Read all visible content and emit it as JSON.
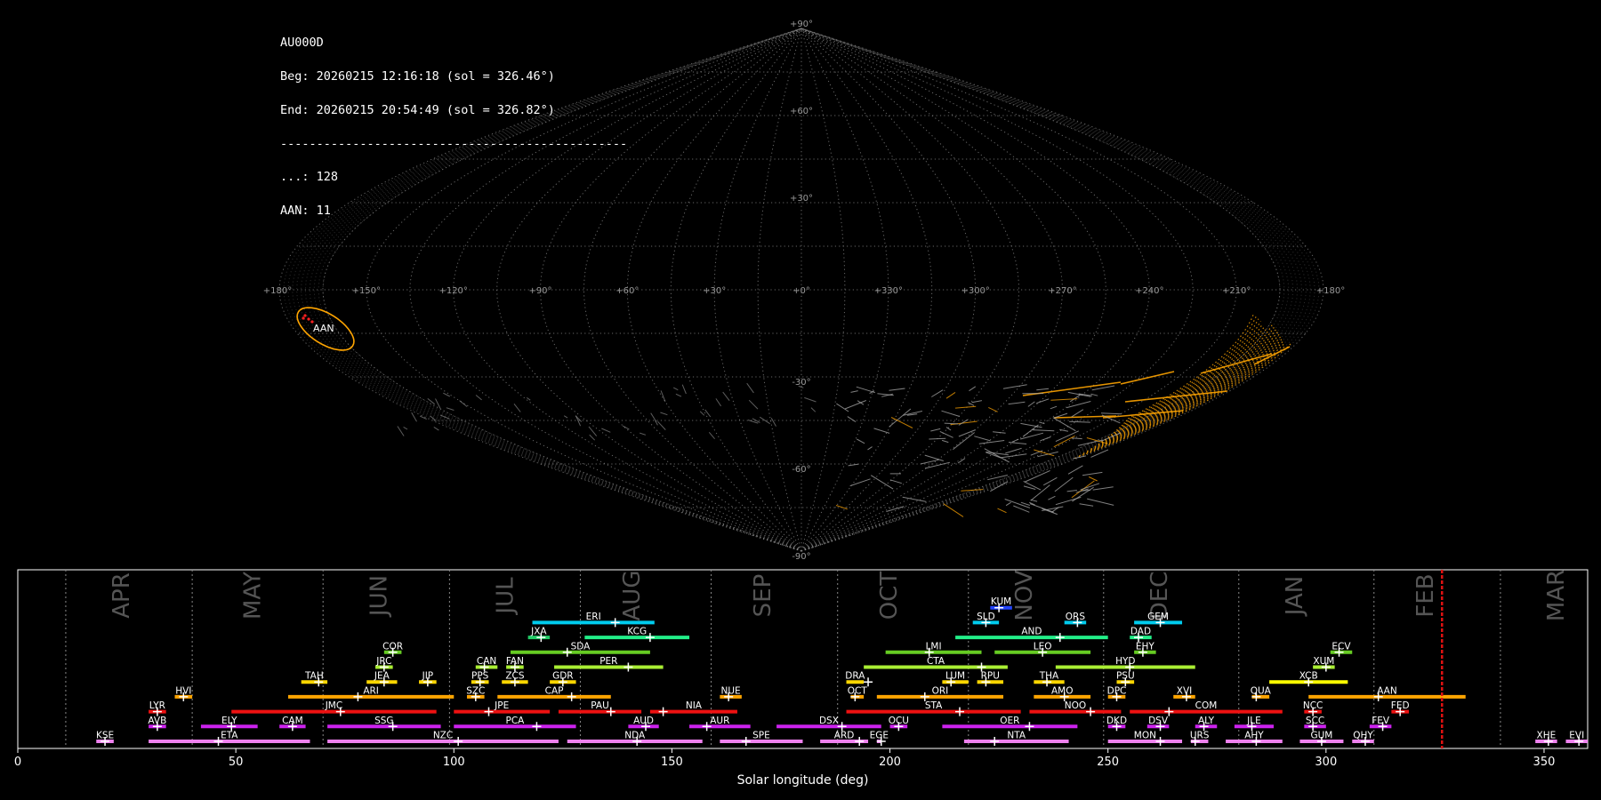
{
  "info": {
    "lines": [
      "AU000D",
      "Beg: 20260215 12:16:18 (sol = 326.46°)",
      "End: 20260215 20:54:49 (sol = 326.82°)",
      "------------------------------------------------",
      "...: 128",
      "AAN: 11"
    ]
  },
  "chart_data": [
    {
      "type": "scatter",
      "projection": "sinusoidal",
      "lon_tick_labels": [
        "+180°",
        "+150°",
        "+120°",
        "+90°",
        "+60°",
        "+30°",
        "+0°",
        "+330°",
        "+300°",
        "+270°",
        "+240°",
        "+210°",
        "+180°"
      ],
      "lat_tick_labels": [
        "+90°",
        "+60°",
        "+30°",
        "-30°",
        "-60°",
        "-90°"
      ],
      "grid": true,
      "annotations": [
        "AAN"
      ],
      "colors": {
        "background": "#000000",
        "grid": "#888888",
        "sporadic": "#aaaaaa",
        "shower": "#ffa500",
        "highlight": "#ff2020"
      }
    },
    {
      "type": "bar",
      "orientation": "horizontal-ranges",
      "xlabel": "Solar longitude (deg)",
      "xlim": [
        0,
        360
      ],
      "xticks": [
        0,
        50,
        100,
        150,
        200,
        250,
        300,
        350
      ],
      "months": [
        {
          "name": "APR",
          "center": 24
        },
        {
          "name": "MAY",
          "center": 54
        },
        {
          "name": "JUN",
          "center": 83
        },
        {
          "name": "JUL",
          "center": 112
        },
        {
          "name": "AUG",
          "center": 141
        },
        {
          "name": "SEP",
          "center": 171
        },
        {
          "name": "OCT",
          "center": 200
        },
        {
          "name": "NOV",
          "center": 231
        },
        {
          "name": "DEC",
          "center": 262
        },
        {
          "name": "JAN",
          "center": 293
        },
        {
          "name": "FEB",
          "center": 323
        },
        {
          "name": "MAR",
          "center": 353
        }
      ],
      "month_boundaries": [
        11,
        40,
        70,
        99,
        129,
        159,
        188,
        218,
        249,
        280,
        311,
        340
      ],
      "current_sol": 326.6,
      "showers": [
        {
          "code": "KSE",
          "start": 18,
          "end": 22,
          "peak": 20,
          "row": 0,
          "color": "#ee82ee"
        },
        {
          "code": "ETA",
          "start": 30,
          "end": 67,
          "peak": 46,
          "row": 0,
          "color": "#ee82ee"
        },
        {
          "code": "NZC",
          "start": 71,
          "end": 124,
          "peak": 101,
          "row": 0,
          "color": "#ee82ee"
        },
        {
          "code": "NDA",
          "start": 126,
          "end": 157,
          "peak": 142,
          "row": 0,
          "color": "#ee82ee"
        },
        {
          "code": "SPE",
          "start": 161,
          "end": 180,
          "peak": 167,
          "row": 0,
          "color": "#ee82ee"
        },
        {
          "code": "ARD",
          "start": 184,
          "end": 195,
          "peak": 193,
          "row": 0,
          "color": "#ee82ee"
        },
        {
          "code": "EGE",
          "start": 197,
          "end": 198,
          "peak": 198,
          "row": 0,
          "color": "#ee82ee"
        },
        {
          "code": "NTA",
          "start": 217,
          "end": 241,
          "peak": 224,
          "row": 0,
          "color": "#ee82ee"
        },
        {
          "code": "MON",
          "start": 250,
          "end": 267,
          "peak": 262,
          "row": 0,
          "color": "#ee82ee"
        },
        {
          "code": "URS",
          "start": 269,
          "end": 273,
          "peak": 270,
          "row": 0,
          "color": "#ee82ee"
        },
        {
          "code": "AHY",
          "start": 277,
          "end": 290,
          "peak": 284,
          "row": 0,
          "color": "#ee82ee"
        },
        {
          "code": "GUM",
          "start": 294,
          "end": 304,
          "peak": 299,
          "row": 0,
          "color": "#ee82ee"
        },
        {
          "code": "QHY",
          "start": 306,
          "end": 311,
          "peak": 309,
          "row": 0,
          "color": "#ee82ee"
        },
        {
          "code": "XHE",
          "start": 348,
          "end": 353,
          "peak": 351,
          "row": 0,
          "color": "#ee82ee"
        },
        {
          "code": "EVI",
          "start": 355,
          "end": 360,
          "peak": 358,
          "row": 0,
          "color": "#ee82ee"
        },
        {
          "code": "AVB",
          "start": 30,
          "end": 34,
          "peak": 32,
          "row": 1,
          "color": "#cc22ee"
        },
        {
          "code": "ELY",
          "start": 42,
          "end": 55,
          "peak": 49,
          "row": 1,
          "color": "#cc22ee"
        },
        {
          "code": "CAM",
          "start": 60,
          "end": 66,
          "peak": 63,
          "row": 1,
          "color": "#cc22ee"
        },
        {
          "code": "SSG",
          "start": 71,
          "end": 97,
          "peak": 86,
          "row": 1,
          "color": "#cc22ee"
        },
        {
          "code": "PCA",
          "start": 100,
          "end": 128,
          "peak": 119,
          "row": 1,
          "color": "#cc22ee"
        },
        {
          "code": "AUD",
          "start": 140,
          "end": 147,
          "peak": 144,
          "row": 1,
          "color": "#cc22ee"
        },
        {
          "code": "AUR",
          "start": 154,
          "end": 168,
          "peak": 158,
          "row": 1,
          "color": "#cc22ee"
        },
        {
          "code": "DSX",
          "start": 174,
          "end": 198,
          "peak": 189,
          "row": 1,
          "color": "#cc22ee"
        },
        {
          "code": "OCU",
          "start": 200,
          "end": 204,
          "peak": 202,
          "row": 1,
          "color": "#cc22ee"
        },
        {
          "code": "OER",
          "start": 212,
          "end": 243,
          "peak": 232,
          "row": 1,
          "color": "#cc22ee"
        },
        {
          "code": "DKD",
          "start": 250,
          "end": 254,
          "peak": 252,
          "row": 1,
          "color": "#cc22ee"
        },
        {
          "code": "DSV",
          "start": 259,
          "end": 264,
          "peak": 262,
          "row": 1,
          "color": "#cc22ee"
        },
        {
          "code": "ALY",
          "start": 270,
          "end": 275,
          "peak": 272,
          "row": 1,
          "color": "#cc22ee"
        },
        {
          "code": "JLE",
          "start": 279,
          "end": 288,
          "peak": 283,
          "row": 1,
          "color": "#cc22ee"
        },
        {
          "code": "SCC",
          "start": 295,
          "end": 300,
          "peak": 297,
          "row": 1,
          "color": "#cc22ee"
        },
        {
          "code": "FEV",
          "start": 310,
          "end": 315,
          "peak": 313,
          "row": 1,
          "color": "#cc22ee"
        },
        {
          "code": "LYR",
          "start": 30,
          "end": 34,
          "peak": 32,
          "row": 2,
          "color": "#ee1111"
        },
        {
          "code": "JMC",
          "start": 49,
          "end": 96,
          "peak": 74,
          "row": 2,
          "color": "#ee1111"
        },
        {
          "code": "JPE",
          "start": 100,
          "end": 122,
          "peak": 108,
          "row": 2,
          "color": "#ee1111"
        },
        {
          "code": "PAU",
          "start": 124,
          "end": 143,
          "peak": 136,
          "row": 2,
          "color": "#ee1111"
        },
        {
          "code": "NIA",
          "start": 145,
          "end": 165,
          "peak": 148,
          "row": 2,
          "color": "#ee1111"
        },
        {
          "code": "STA",
          "start": 190,
          "end": 230,
          "peak": 216,
          "row": 2,
          "color": "#ee1111"
        },
        {
          "code": "NOO",
          "start": 232,
          "end": 253,
          "peak": 246,
          "row": 2,
          "color": "#ee1111"
        },
        {
          "code": "COM",
          "start": 255,
          "end": 290,
          "peak": 264,
          "row": 2,
          "color": "#ee1111"
        },
        {
          "code": "NCC",
          "start": 295,
          "end": 299,
          "peak": 297,
          "row": 2,
          "color": "#ee1111"
        },
        {
          "code": "FED",
          "start": 315,
          "end": 319,
          "peak": 317,
          "row": 2,
          "color": "#ee1111"
        },
        {
          "code": "HVI",
          "start": 36,
          "end": 40,
          "peak": 38,
          "row": 3,
          "color": "#ffa500"
        },
        {
          "code": "ARI",
          "start": 62,
          "end": 100,
          "peak": 78,
          "row": 3,
          "color": "#ffa500"
        },
        {
          "code": "SZC",
          "start": 103,
          "end": 107,
          "peak": 105,
          "row": 3,
          "color": "#ffa500"
        },
        {
          "code": "CAP",
          "start": 110,
          "end": 136,
          "peak": 127,
          "row": 3,
          "color": "#ffa500"
        },
        {
          "code": "NUE",
          "start": 161,
          "end": 166,
          "peak": 163,
          "row": 3,
          "color": "#ffa500"
        },
        {
          "code": "OCT",
          "start": 191,
          "end": 194,
          "peak": 192,
          "row": 3,
          "color": "#ffa500"
        },
        {
          "code": "ORI",
          "start": 197,
          "end": 226,
          "peak": 208,
          "row": 3,
          "color": "#ffa500"
        },
        {
          "code": "AMO",
          "start": 233,
          "end": 246,
          "peak": 240,
          "row": 3,
          "color": "#ffa500"
        },
        {
          "code": "DPC",
          "start": 250,
          "end": 254,
          "peak": 252,
          "row": 3,
          "color": "#ffa500"
        },
        {
          "code": "XVI",
          "start": 265,
          "end": 270,
          "peak": 268,
          "row": 3,
          "color": "#ffa500"
        },
        {
          "code": "QUA",
          "start": 283,
          "end": 287,
          "peak": 284,
          "row": 3,
          "color": "#ffa500"
        },
        {
          "code": "AAN",
          "start": 296,
          "end": 332,
          "peak": 312,
          "row": 3,
          "color": "#ffa500"
        },
        {
          "code": "TAH",
          "start": 65,
          "end": 71,
          "peak": 69,
          "row": 4,
          "color": "#ffd700"
        },
        {
          "code": "JEA",
          "start": 80,
          "end": 87,
          "peak": 84,
          "row": 4,
          "color": "#ffd700"
        },
        {
          "code": "JIP",
          "start": 92,
          "end": 96,
          "peak": 94,
          "row": 4,
          "color": "#ffd700"
        },
        {
          "code": "PPS",
          "start": 104,
          "end": 108,
          "peak": 106,
          "row": 4,
          "color": "#ffd700"
        },
        {
          "code": "ZCS",
          "start": 111,
          "end": 117,
          "peak": 114,
          "row": 4,
          "color": "#ffd700"
        },
        {
          "code": "GDR",
          "start": 122,
          "end": 128,
          "peak": 125,
          "row": 4,
          "color": "#ffd700"
        },
        {
          "code": "DRA",
          "start": 190,
          "end": 194,
          "peak": 195,
          "row": 4,
          "color": "#ffd700"
        },
        {
          "code": "LUM",
          "start": 212,
          "end": 218,
          "peak": 214,
          "row": 4,
          "color": "#ffd700"
        },
        {
          "code": "RPU",
          "start": 220,
          "end": 226,
          "peak": 222,
          "row": 4,
          "color": "#ffd700"
        },
        {
          "code": "THA",
          "start": 233,
          "end": 240,
          "peak": 236,
          "row": 4,
          "color": "#ffd700"
        },
        {
          "code": "PSU",
          "start": 252,
          "end": 256,
          "peak": 254,
          "row": 4,
          "color": "#ffd700"
        },
        {
          "code": "XCB",
          "start": 287,
          "end": 305,
          "peak": 296,
          "row": 4,
          "color": "#ffff00"
        },
        {
          "code": "JRC",
          "start": 82,
          "end": 86,
          "peak": 84,
          "row": 5,
          "color": "#aaee33"
        },
        {
          "code": "CAN",
          "start": 105,
          "end": 110,
          "peak": 107,
          "row": 5,
          "color": "#aaee33"
        },
        {
          "code": "FAN",
          "start": 112,
          "end": 116,
          "peak": 114,
          "row": 5,
          "color": "#aaee33"
        },
        {
          "code": "PER",
          "start": 123,
          "end": 148,
          "peak": 140,
          "row": 5,
          "color": "#aaee33"
        },
        {
          "code": "CTA",
          "start": 194,
          "end": 227,
          "peak": 221,
          "row": 5,
          "color": "#aaee33"
        },
        {
          "code": "HYD",
          "start": 238,
          "end": 270,
          "peak": 255,
          "row": 5,
          "color": "#aaee33"
        },
        {
          "code": "XUM",
          "start": 297,
          "end": 302,
          "peak": 300,
          "row": 5,
          "color": "#aaee33"
        },
        {
          "code": "COR",
          "start": 84,
          "end": 88,
          "peak": 86,
          "row": 6,
          "color": "#66cc22"
        },
        {
          "code": "SDA",
          "start": 113,
          "end": 145,
          "peak": 126,
          "row": 6,
          "color": "#66cc22"
        },
        {
          "code": "LMI",
          "start": 199,
          "end": 221,
          "peak": 209,
          "row": 6,
          "color": "#66cc22"
        },
        {
          "code": "LEO",
          "start": 224,
          "end": 246,
          "peak": 235,
          "row": 6,
          "color": "#66cc22"
        },
        {
          "code": "EHY",
          "start": 256,
          "end": 261,
          "peak": 258,
          "row": 6,
          "color": "#66cc22"
        },
        {
          "code": "ECV",
          "start": 301,
          "end": 306,
          "peak": 303,
          "row": 6,
          "color": "#66cc22"
        },
        {
          "code": "JXA",
          "start": 117,
          "end": 122,
          "peak": 120,
          "row": 7,
          "color": "#22cc66"
        },
        {
          "code": "KCG",
          "start": 130,
          "end": 154,
          "peak": 145,
          "row": 7,
          "color": "#22ee88"
        },
        {
          "code": "AND",
          "start": 215,
          "end": 250,
          "peak": 239,
          "row": 7,
          "color": "#22ee88"
        },
        {
          "code": "DAD",
          "start": 255,
          "end": 260,
          "peak": 257,
          "row": 7,
          "color": "#22ee88"
        },
        {
          "code": "ERI",
          "start": 118,
          "end": 146,
          "peak": 137,
          "row": 8,
          "color": "#00ccee"
        },
        {
          "code": "SLD",
          "start": 219,
          "end": 225,
          "peak": 222,
          "row": 8,
          "color": "#00ccee"
        },
        {
          "code": "ORS",
          "start": 240,
          "end": 245,
          "peak": 243,
          "row": 8,
          "color": "#00ccee"
        },
        {
          "code": "GEM",
          "start": 256,
          "end": 267,
          "peak": 262,
          "row": 8,
          "color": "#00ccee"
        },
        {
          "code": "KUM",
          "start": 223,
          "end": 228,
          "peak": 225,
          "row": 9,
          "color": "#2244ff"
        }
      ],
      "colors": {
        "axis": "#ffffff",
        "month_text": "#555555",
        "boundary": "#888888",
        "current_line": "#dd1111"
      }
    }
  ]
}
